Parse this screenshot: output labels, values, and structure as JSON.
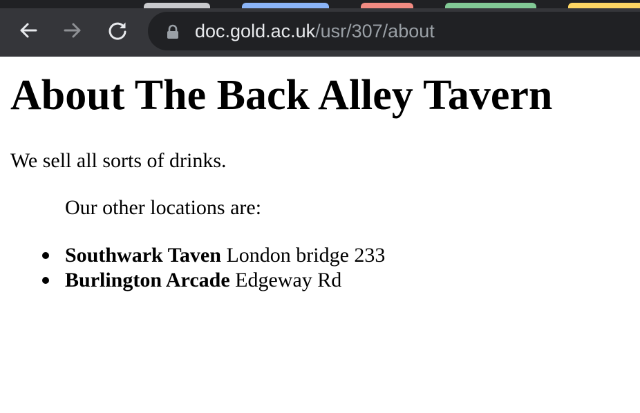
{
  "browser": {
    "tab_colors": [
      "#c9cacd",
      "#8ab4f8",
      "#f28b82",
      "#81c995",
      "#fdd663"
    ],
    "address_bar": {
      "host": "doc.gold.ac.uk",
      "path": "/usr/307/about"
    },
    "icons": {
      "back": "arrow-left-icon",
      "forward": "arrow-right-icon",
      "reload": "reload-icon",
      "lock": "lock-icon"
    }
  },
  "page": {
    "title": "About The Back Alley Tavern",
    "intro": "We sell all sorts of drinks.",
    "locations_heading": "Our other locations are:",
    "locations": [
      {
        "name": "Southwark Taven",
        "address": "London bridge 233"
      },
      {
        "name": "Burlington Arcade",
        "address": "Edgeway Rd"
      }
    ]
  }
}
